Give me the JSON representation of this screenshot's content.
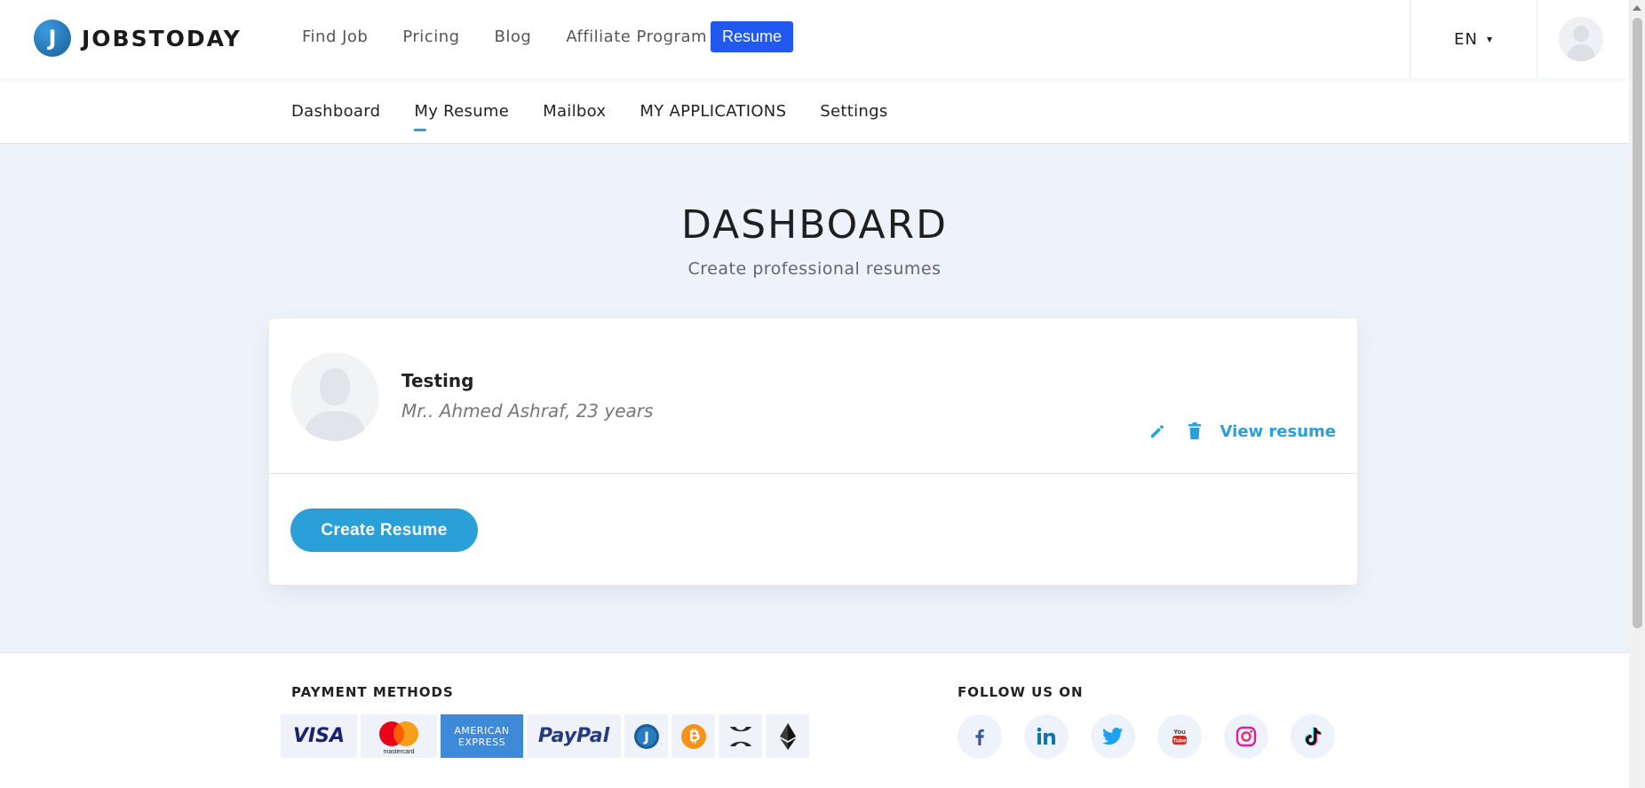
{
  "header": {
    "logo_letter": "J",
    "logo_text": "JOBSTODAY",
    "nav": [
      "Find Job",
      "Pricing",
      "Blog",
      "Affiliate Program"
    ],
    "resume_button": "Resume",
    "language": "EN"
  },
  "subnav": {
    "tabs": [
      "Dashboard",
      "My Resume",
      "Mailbox",
      "MY APPLICATIONS",
      "Settings"
    ],
    "active_tab": "My Resume"
  },
  "main": {
    "title": "DASHBOARD",
    "subtitle": "Create professional resumes",
    "resume": {
      "title": "Testing",
      "meta": "Mr.. Ahmed Ashraf, 23 years",
      "view_link": "View resume"
    },
    "create_button": "Create Resume"
  },
  "footer": {
    "payment_heading": "PAYMENT METHODS",
    "payment_methods": {
      "visa": "VISA",
      "mastercard": "mastercard",
      "amex_line1": "AMERICAN",
      "amex_line2": "EXPRESS",
      "paypal": "PayPal",
      "jobstoday_coin": "J"
    },
    "social_heading": "FOLLOW US ON",
    "social_icons": [
      "facebook-icon",
      "linkedin-icon",
      "twitter-icon",
      "youtube-icon",
      "instagram-icon",
      "tiktok-icon"
    ]
  },
  "colors": {
    "accent": "#2a9fd8",
    "resume_button": "#2058f0",
    "page_background": "#eef2fa"
  }
}
